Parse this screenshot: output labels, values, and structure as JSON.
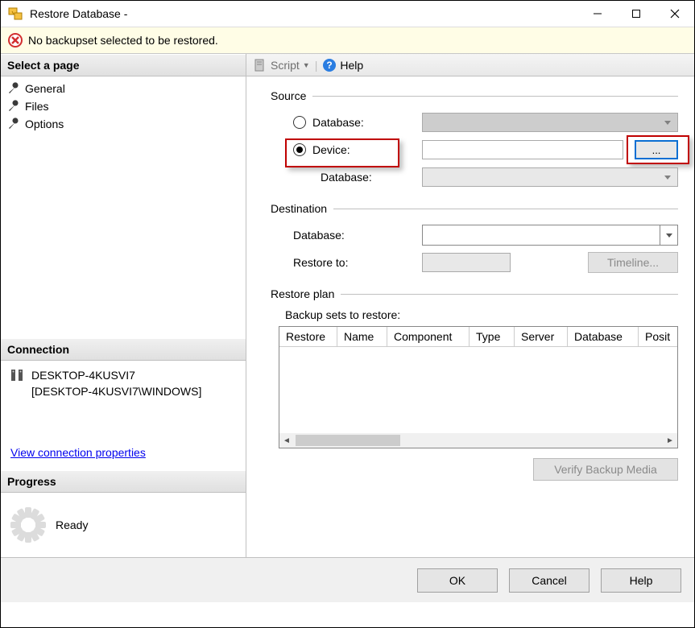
{
  "title": "Restore Database -",
  "warning": "No backupset selected to be restored.",
  "sidebar": {
    "select_page": "Select a page",
    "pages": [
      "General",
      "Files",
      "Options"
    ],
    "connection": {
      "header": "Connection",
      "server": "DESKTOP-4KUSVI7",
      "user": "[DESKTOP-4KUSVI7\\WINDOWS]",
      "link": "View connection properties"
    },
    "progress": {
      "header": "Progress",
      "state": "Ready"
    }
  },
  "toolbar": {
    "script": "Script",
    "help": "Help"
  },
  "source": {
    "group": "Source",
    "database_label": "Database:",
    "device_label": "Device:",
    "sub_database_label": "Database:",
    "browse": "..."
  },
  "destination": {
    "group": "Destination",
    "database_label": "Database:",
    "restore_to_label": "Restore to:",
    "timeline_btn": "Timeline..."
  },
  "restore_plan": {
    "group": "Restore plan",
    "subtitle": "Backup sets to restore:",
    "columns": [
      "Restore",
      "Name",
      "Component",
      "Type",
      "Server",
      "Database",
      "Posit"
    ]
  },
  "buttons": {
    "verify": "Verify Backup Media",
    "ok": "OK",
    "cancel": "Cancel",
    "help": "Help"
  }
}
